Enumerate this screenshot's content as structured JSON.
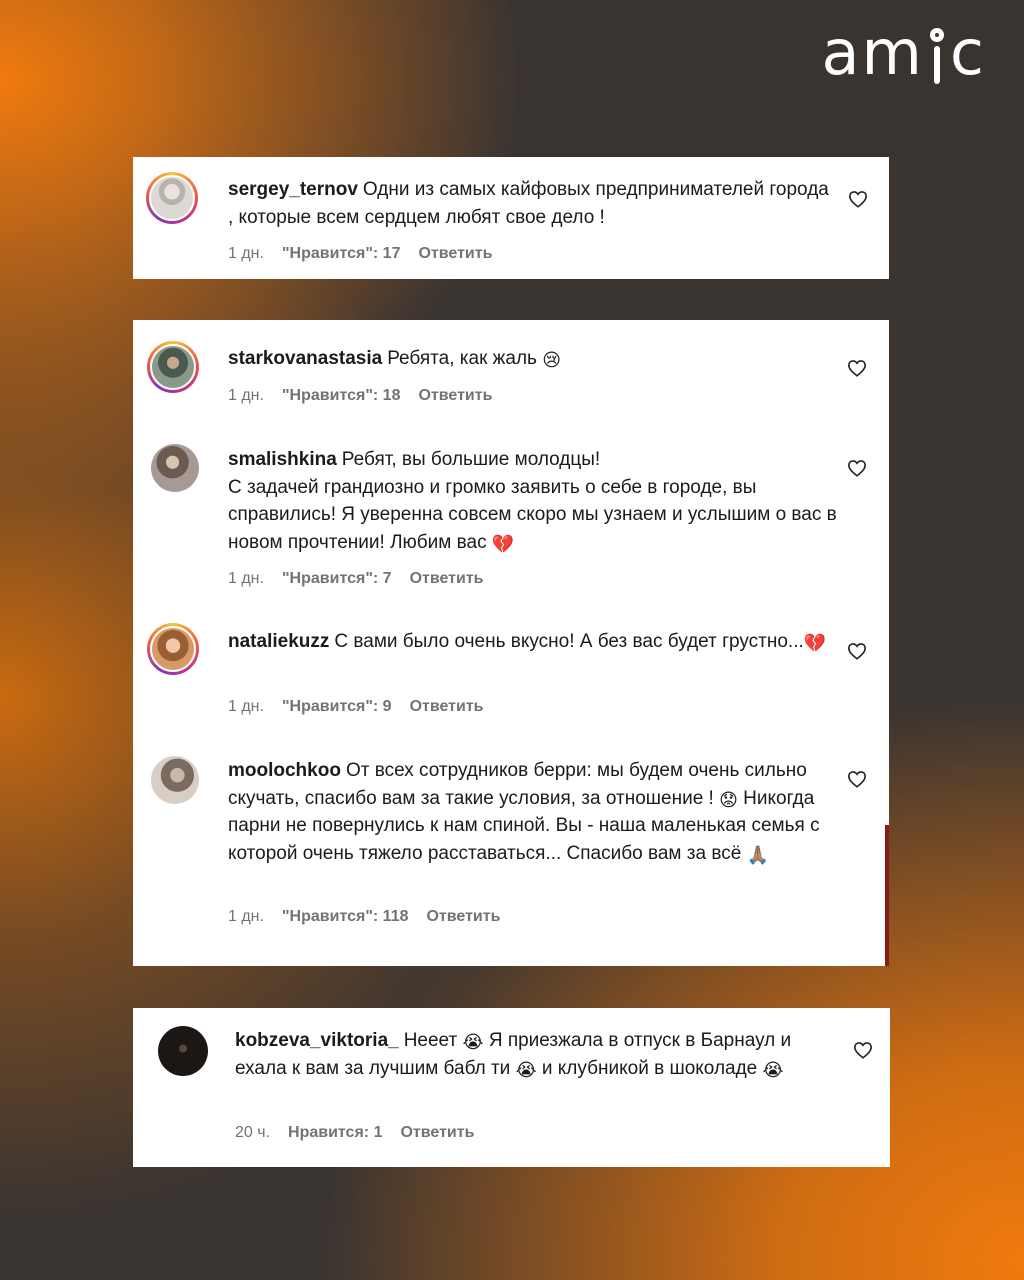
{
  "brand": "amic",
  "cards": [
    {
      "comments": [
        {
          "user": "sergey_ternov",
          "text": "Одни из самых кайфовых предпринимателей города , которые всем сердцем любят свое дело !",
          "time": "1 дн.",
          "likes": "\"Нравится\": 17",
          "reply": "Ответить"
        }
      ]
    },
    {
      "comments": [
        {
          "user": "starkovanastasia",
          "text": "Ребята, как жаль",
          "emoji": "😢",
          "time": "1 дн.",
          "likes": "\"Нравится\": 18",
          "reply": "Ответить"
        },
        {
          "user": "smalishkina",
          "text": "Ребят, вы большие молодцы!",
          "text2": "С задачей грандиозно и громко заявить о себе в городе, вы справились! Я уверенна совсем скоро мы узнаем и услышим о вас в новом прочтении! Любим вас",
          "emoji": "💔",
          "time": "1 дн.",
          "likes": "\"Нравится\": 7",
          "reply": "Ответить"
        },
        {
          "user": "nataliekuzz",
          "text": "С вами было очень вкусно! А без вас будет грустно...",
          "emoji": "💔",
          "time": "1 дн.",
          "likes": "\"Нравится\": 9",
          "reply": "Ответить"
        },
        {
          "user": "moolochkoo",
          "text_a": "От всех сотрудников берри: мы будем очень сильно скучать, спасибо вам за такие условия, за отношение !",
          "emoji_a": "😟",
          "text_b": "Никогда парни не повернулись к нам спиной. Вы - наша маленькая семья с которой очень тяжело расставаться... Спасибо вам за всё",
          "emoji_b": "🙏🏽",
          "time": "1 дн.",
          "likes": "\"Нравится\": 118",
          "reply": "Ответить"
        }
      ]
    },
    {
      "comments": [
        {
          "user": "kobzeva_viktoria_",
          "text_a": "Нееет",
          "emoji": "😭",
          "text_b": "Я приезжала в отпуск в Барнаул и ехала к вам за лучшим бабл ти",
          "text_c": "и клубникой в шоколаде",
          "time": "20 ч.",
          "likes": "Нравится: 1",
          "reply": "Ответить"
        }
      ]
    }
  ],
  "icons": {
    "like": "heart-outline-icon"
  },
  "colors": {
    "accent_orange": "#f07a0e",
    "background_dark": "#3a3431",
    "meta_gray": "#737373"
  }
}
